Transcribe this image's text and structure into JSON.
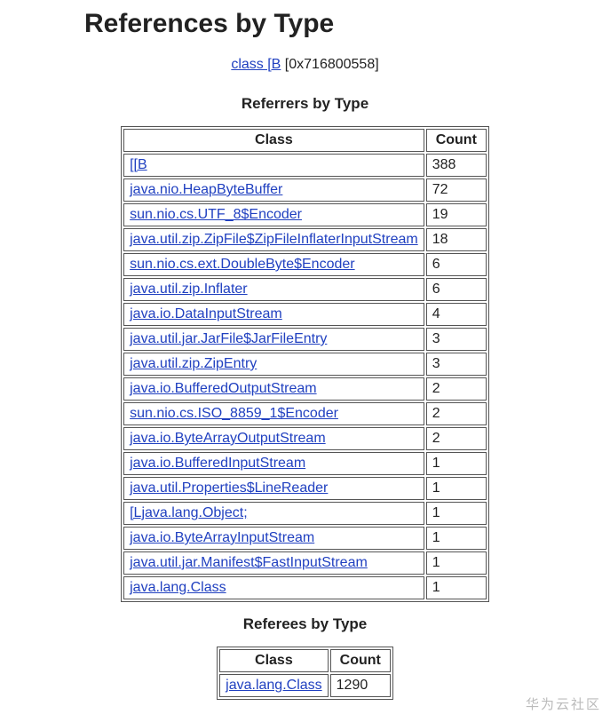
{
  "pageTitle": "References by Type",
  "subject": {
    "linkText": "class [B",
    "address": "[0x716800558]"
  },
  "referrers": {
    "heading": "Referrers by Type",
    "columns": [
      "Class",
      "Count"
    ],
    "rows": [
      {
        "class": "[[B",
        "count": 388
      },
      {
        "class": "java.nio.HeapByteBuffer",
        "count": 72
      },
      {
        "class": "sun.nio.cs.UTF_8$Encoder",
        "count": 19
      },
      {
        "class": "java.util.zip.ZipFile$ZipFileInflaterInputStream",
        "count": 18
      },
      {
        "class": "sun.nio.cs.ext.DoubleByte$Encoder",
        "count": 6
      },
      {
        "class": "java.util.zip.Inflater",
        "count": 6
      },
      {
        "class": "java.io.DataInputStream",
        "count": 4
      },
      {
        "class": "java.util.jar.JarFile$JarFileEntry",
        "count": 3
      },
      {
        "class": "java.util.zip.ZipEntry",
        "count": 3
      },
      {
        "class": "java.io.BufferedOutputStream",
        "count": 2
      },
      {
        "class": "sun.nio.cs.ISO_8859_1$Encoder",
        "count": 2
      },
      {
        "class": "java.io.ByteArrayOutputStream",
        "count": 2
      },
      {
        "class": "java.io.BufferedInputStream",
        "count": 1
      },
      {
        "class": "java.util.Properties$LineReader",
        "count": 1
      },
      {
        "class": "[Ljava.lang.Object;",
        "count": 1
      },
      {
        "class": "java.io.ByteArrayInputStream",
        "count": 1
      },
      {
        "class": "java.util.jar.Manifest$FastInputStream",
        "count": 1
      },
      {
        "class": "java.lang.Class",
        "count": 1
      }
    ]
  },
  "referees": {
    "heading": "Referees by Type",
    "columns": [
      "Class",
      "Count"
    ],
    "rows": [
      {
        "class": "java.lang.Class",
        "count": 1290
      }
    ]
  },
  "watermark": "华为云社区"
}
